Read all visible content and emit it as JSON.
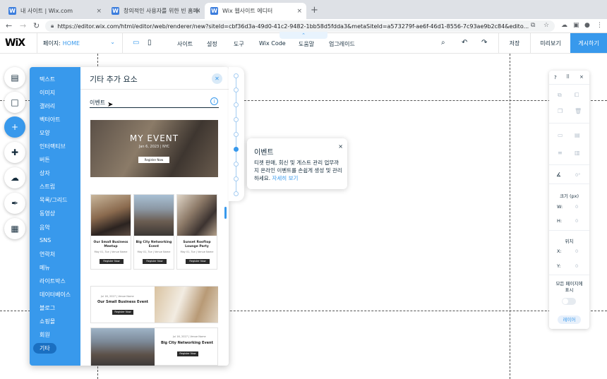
{
  "browser": {
    "tabs": [
      {
        "title": "내 사이트 | Wix.com",
        "close": "×"
      },
      {
        "title": "창의적인 사용자를 위한 빈 홈페이지",
        "close": "×"
      },
      {
        "title": "Wix 웹사이트 에디터",
        "close": "×"
      }
    ],
    "new_tab": "+",
    "url": "https://editor.wix.com/html/editor/web/renderer/new?siteId=cbf36d3a-49d0-41c2-9482-1bb58d5fdda3&metaSiteId=a573279f-ae6f-46d1-8556-7c93ae9b2c84&edito..."
  },
  "wix_bar": {
    "logo": "WiX",
    "page_label": "페이지:",
    "page_value": "HOME",
    "menu": [
      "사이트",
      "설정",
      "도구",
      "Wix Code",
      "도움말",
      "업그레이드"
    ],
    "save": "저장",
    "preview": "미리보기",
    "publish": "게시하기",
    "collapse": "⌃"
  },
  "add_panel": {
    "title": "기타 추가 요소",
    "categories": [
      "텍스트",
      "이미지",
      "갤러리",
      "벡터아트",
      "모양",
      "인터랙티브",
      "버튼",
      "상자",
      "스트립",
      "목록/그리드",
      "동영상",
      "음악",
      "SNS",
      "연락처",
      "메뉴",
      "라이트박스",
      "데이터베이스",
      "블로그",
      "쇼핑몰",
      "회원",
      "기타"
    ],
    "section": "이벤트",
    "hero": {
      "title": "MY EVENT",
      "date": "Jan 6, 2023 | NYC",
      "button": "Register Now"
    },
    "cards": [
      {
        "name": "Our Small Business Meetup",
        "date": "May 01, Tue | Venue Name",
        "button": "Register Now"
      },
      {
        "name": "Big City Networking Event",
        "date": "May 01, Tue | Venue Name",
        "button": "Register Now"
      },
      {
        "name": "Sunset Rooftop Lounge Party",
        "date": "May 01, Tue | Venue Name",
        "button": "Register Now"
      }
    ],
    "row_event": {
      "date": "Jul 16, 2027 | Venue Name",
      "name": "Our Small Business Event",
      "button": "Register Now"
    },
    "row_event2": {
      "date": "Jul 16, 2027 | Venue Name",
      "name": "Big City Networking Event",
      "button": "Register Now"
    }
  },
  "tooltip": {
    "title": "이벤트",
    "body": "티켓 판매, 회신 및 게스트 관리 업무까지 온라인 이벤트를 손쉽게 생성 및 관리하세요.",
    "link": "자세히 보기",
    "close": "×"
  },
  "right_panel": {
    "help": "?",
    "close": "×",
    "angle": "0°",
    "size_label": "크기 (px)",
    "w_label": "W:",
    "w_value": "0",
    "h_label": "H:",
    "h_value": "0",
    "pos_label": "위치",
    "x_label": "X:",
    "x_value": "0",
    "y_label": "Y:",
    "y_value": "0",
    "show_all": "모든 페이지에 표시",
    "layers": "레이어"
  },
  "colors": {
    "accent": "#3899ec",
    "text": "#162d3d"
  }
}
